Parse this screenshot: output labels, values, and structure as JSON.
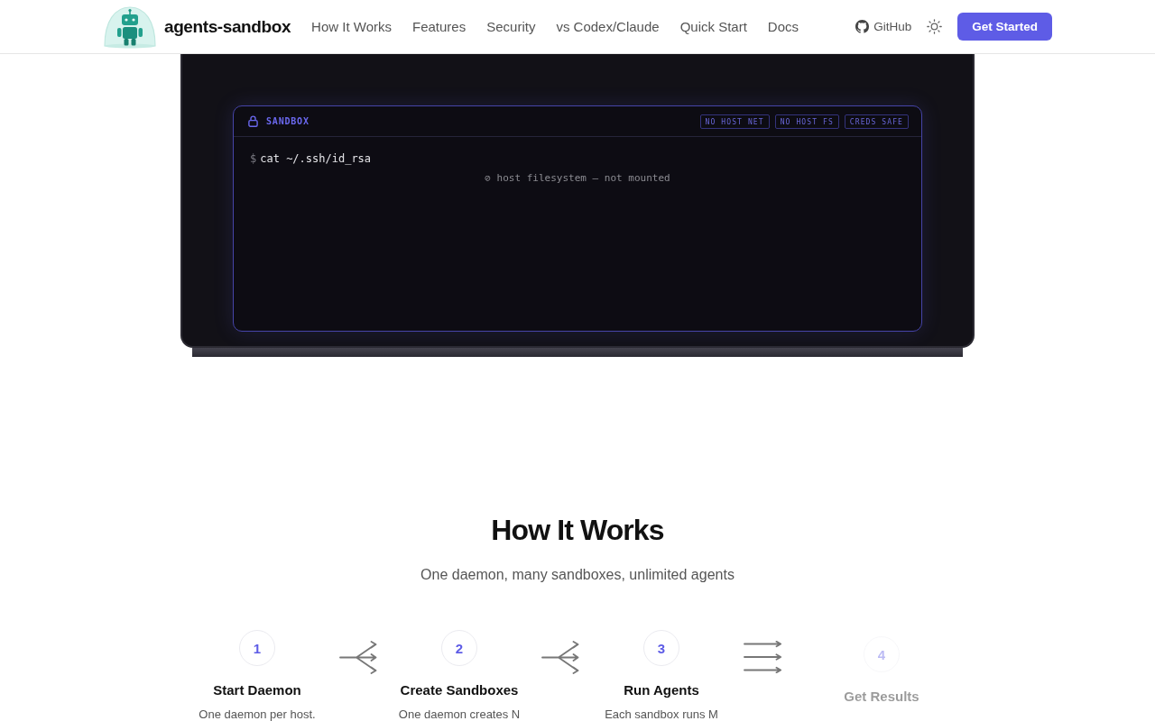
{
  "header": {
    "brand": "agents-sandbox",
    "nav": [
      "How It Works",
      "Features",
      "Security",
      "vs Codex/Claude",
      "Quick Start",
      "Docs"
    ],
    "github": "GitHub",
    "cta": "Get Started"
  },
  "demo": {
    "label": "SANDBOX",
    "badges": [
      "NO HOST NET",
      "NO HOST FS",
      "CREDS SAFE"
    ],
    "lines": [
      {
        "kind": "command",
        "prompt": "$",
        "text": "cat ~/.ssh/id_rsa"
      },
      {
        "kind": "notice",
        "text": "⊘ host filesystem — not mounted"
      }
    ]
  },
  "how_it_works": {
    "title": "How It Works",
    "subtitle": "One daemon, many sandboxes, unlimited agents",
    "steps": [
      {
        "number": "1",
        "title": "Start Daemon",
        "description": "One daemon per host.",
        "faded": false
      },
      {
        "number": "2",
        "title": "Create Sandboxes",
        "description": "One daemon creates N",
        "faded": false
      },
      {
        "number": "3",
        "title": "Run Agents",
        "description": "Each sandbox runs M",
        "faded": false
      },
      {
        "number": "4",
        "title": "Get Results",
        "faded": true
      }
    ],
    "connectors": [
      {
        "kind": "split"
      },
      {
        "kind": "split"
      },
      {
        "kind": "parallel"
      }
    ]
  }
}
